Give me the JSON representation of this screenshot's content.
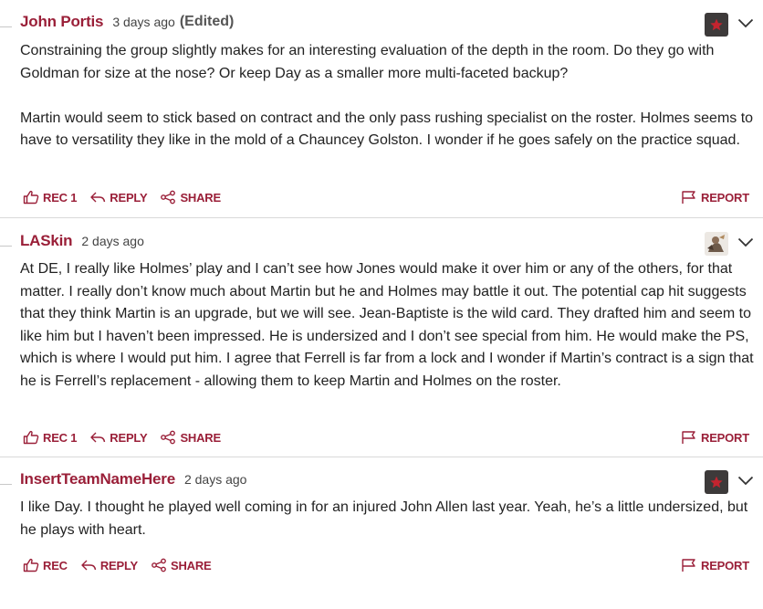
{
  "colors": {
    "accent": "#9a1f38",
    "text": "#222222",
    "muted": "#444444",
    "divider": "#d9d9d9",
    "avatar_bg": "#3d3a3a",
    "star": "#c4242f"
  },
  "comments": [
    {
      "author": "John Portis",
      "time": "3 days ago",
      "edited": "(Edited)",
      "avatar": "star-icon",
      "paragraphs": [
        "Constraining the group slightly makes for an interesting evaluation of the depth in the room. Do they go with Goldman for size at the nose? Or keep Day as a smaller more multi-faceted backup?",
        "Martin would seem to stick based on contract and the only pass rushing specialist on the roster. Holmes seems to have to versatility they like in the mold of a Chauncey Golston. I wonder if he goes safely on the practice squad."
      ],
      "actions": {
        "rec": "Rec 1",
        "reply": "Reply",
        "share": "Share",
        "report": "Report"
      }
    },
    {
      "author": "LASkin",
      "time": "2 days ago",
      "edited": "",
      "avatar": "user-photo",
      "paragraphs": [
        "At DE, I really like Holmes’ play and I can’t see how Jones would make it over him or any of the others, for that matter. I really don’t know much about Martin but he and Holmes may battle it out. The potential cap hit suggests that they think Martin is an upgrade, but we will see. Jean-Baptiste is the wild card. They drafted him and seem to like him but I haven’t been impressed. He is undersized and I don’t see special from him. He would make the PS, which is where I would put him. I agree that Ferrell is far from a lock and I wonder if Martin’s contract is a sign that he is Ferrell’s replacement - allowing them to keep Martin and Holmes on the roster."
      ],
      "actions": {
        "rec": "Rec 1",
        "reply": "Reply",
        "share": "Share",
        "report": "Report"
      }
    },
    {
      "author": "InsertTeamNameHere",
      "time": "2 days ago",
      "edited": "",
      "avatar": "star-icon",
      "paragraphs": [
        "I like Day. I thought he played well coming in for an injured John Allen last year. Yeah, he’s a little undersized, but he plays with heart."
      ],
      "actions": {
        "rec": "Rec",
        "reply": "Reply",
        "share": "Share",
        "report": "Report"
      }
    }
  ]
}
